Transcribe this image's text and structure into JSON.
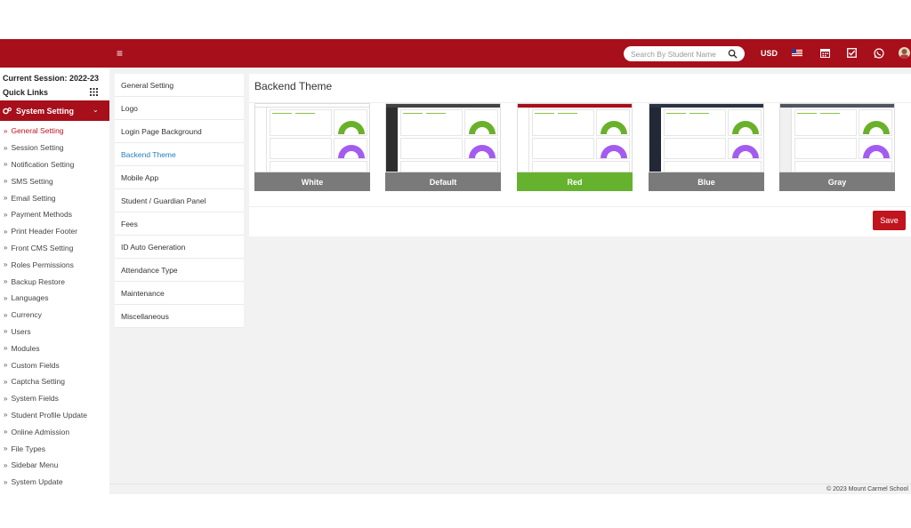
{
  "topbar": {
    "search_placeholder": "Search By Student Name",
    "currency": "USD"
  },
  "sidebar": {
    "session": "Current Session: 2022-23",
    "quick_links": "Quick Links",
    "section_label": "System Setting",
    "items": [
      {
        "label": "General Setting"
      },
      {
        "label": "Session Setting"
      },
      {
        "label": "Notification Setting"
      },
      {
        "label": "SMS Setting"
      },
      {
        "label": "Email Setting"
      },
      {
        "label": "Payment Methods"
      },
      {
        "label": "Print Header Footer"
      },
      {
        "label": "Front CMS Setting"
      },
      {
        "label": "Roles Permissions"
      },
      {
        "label": "Backup Restore"
      },
      {
        "label": "Languages"
      },
      {
        "label": "Currency"
      },
      {
        "label": "Users"
      },
      {
        "label": "Modules"
      },
      {
        "label": "Custom Fields"
      },
      {
        "label": "Captcha Setting"
      },
      {
        "label": "System Fields"
      },
      {
        "label": "Student Profile Update"
      },
      {
        "label": "Online Admission"
      },
      {
        "label": "File Types"
      },
      {
        "label": "Sidebar Menu"
      },
      {
        "label": "System Update"
      }
    ]
  },
  "settings_menu": {
    "items": [
      {
        "label": "General Setting"
      },
      {
        "label": "Logo"
      },
      {
        "label": "Login Page Background"
      },
      {
        "label": "Backend Theme"
      },
      {
        "label": "Mobile App"
      },
      {
        "label": "Student / Guardian Panel"
      },
      {
        "label": "Fees"
      },
      {
        "label": "ID Auto Generation"
      },
      {
        "label": "Attendance Type"
      },
      {
        "label": "Maintenance"
      },
      {
        "label": "Miscellaneous"
      }
    ]
  },
  "panel": {
    "title": "Backend Theme",
    "save_label": "Save",
    "themes": [
      {
        "label": "White",
        "top_color": "#ffffff",
        "side_color": "#ffffff"
      },
      {
        "label": "Default",
        "top_color": "#424242",
        "side_color": "#2e2e2e"
      },
      {
        "label": "Red",
        "top_color": "#a70f1a",
        "side_color": "#ffffff"
      },
      {
        "label": "Blue",
        "top_color": "#2b3245",
        "side_color": "#222836"
      },
      {
        "label": "Gray",
        "top_color": "#4e5560",
        "side_color": "#f0f0f0"
      }
    ]
  },
  "footer": {
    "copyright": "© 2023 Mount Carmel School"
  },
  "colors": {
    "brand": "#a70f1a",
    "selected_theme": "#65b22f",
    "active_menu": "#1f7fc0"
  }
}
